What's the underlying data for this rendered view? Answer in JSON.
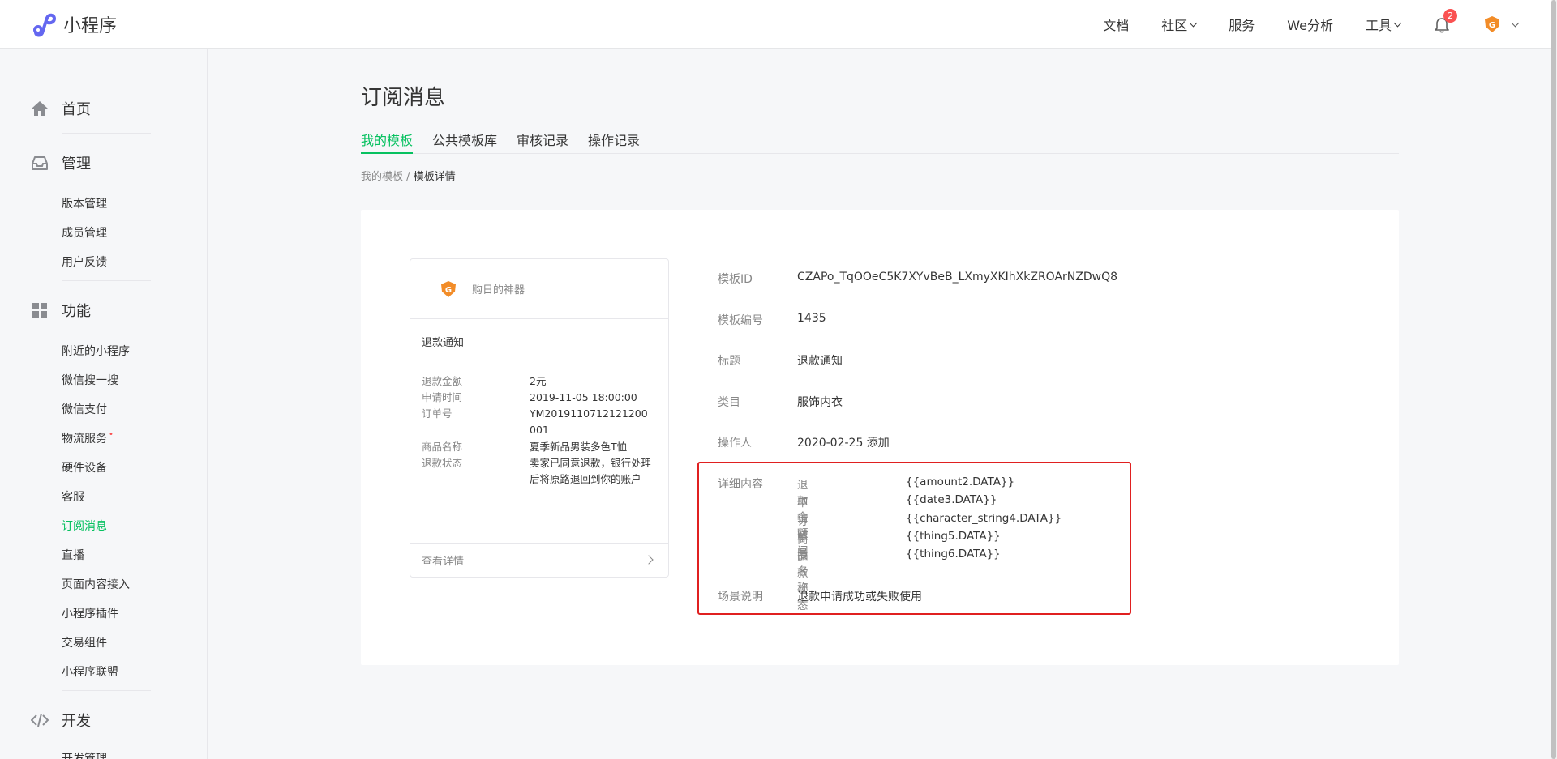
{
  "header": {
    "logo_text": "小程序",
    "nav": [
      {
        "label": "文档",
        "dropdown": false
      },
      {
        "label": "社区",
        "dropdown": true
      },
      {
        "label": "服务",
        "dropdown": false
      },
      {
        "label": "We分析",
        "dropdown": false
      },
      {
        "label": "工具",
        "dropdown": true
      }
    ],
    "notification_count": "2"
  },
  "sidebar": {
    "groups": [
      {
        "label": "首页",
        "icon": "home-icon"
      },
      {
        "label": "管理",
        "icon": "inbox-icon",
        "items": [
          "版本管理",
          "成员管理",
          "用户反馈"
        ]
      },
      {
        "label": "功能",
        "icon": "grid-icon",
        "items": [
          "附近的小程序",
          "微信搜一搜",
          "微信支付",
          "物流服务",
          "硬件设备",
          "客服",
          "订阅消息",
          "直播",
          "页面内容接入",
          "小程序插件",
          "交易组件",
          "小程序联盟"
        ]
      },
      {
        "label": "开发",
        "icon": "code-icon",
        "items": [
          "开发管理"
        ]
      }
    ],
    "active_item": "订阅消息",
    "new_dot": "•"
  },
  "page": {
    "title": "订阅消息",
    "tabs": [
      "我的模板",
      "公共模板库",
      "审核记录",
      "操作记录"
    ],
    "active_tab": "我的模板",
    "breadcrumb": {
      "parent": "我的模板",
      "separator": "/",
      "current": "模板详情"
    }
  },
  "preview": {
    "app_name": "购日的神器",
    "title": "退款通知",
    "fields": [
      {
        "key": "退款金额",
        "value": "2元"
      },
      {
        "key": "申请时间",
        "value": "2019-11-05 18:00:00"
      },
      {
        "key": "订单号",
        "value": "YM2019110712121200001"
      },
      {
        "key": "商品名称",
        "value": "夏季新品男装多色T恤"
      },
      {
        "key": "退款状态",
        "value": "卖家已同意退款，银行处理后将原路退回到你的账户"
      }
    ],
    "footer_link": "查看详情"
  },
  "template": {
    "rows": [
      {
        "label": "模板ID",
        "value": "CZAPo_TqOOeC5K7XYvBeB_LXmyXKIhXkZROArNZDwQ8"
      },
      {
        "label": "模板编号",
        "value": "1435"
      },
      {
        "label": "标题",
        "value": "退款通知"
      },
      {
        "label": "类目",
        "value": "服饰内衣"
      },
      {
        "label": "操作人",
        "value": "2020-02-25 添加"
      }
    ],
    "detail_label": "详细内容",
    "detail": [
      {
        "key": "退款金额",
        "value": "{{amount2.DATA}}"
      },
      {
        "key": "申请时间",
        "value": "{{date3.DATA}}"
      },
      {
        "key": "订单号",
        "value": "{{character_string4.DATA}}"
      },
      {
        "key": "商品名称",
        "value": "{{thing5.DATA}}"
      },
      {
        "key": "退款状态",
        "value": "{{thing6.DATA}}"
      }
    ],
    "scene_label": "场景说明",
    "scene_value": "退款申请成功或失败使用"
  },
  "colors": {
    "accent": "#07c160",
    "highlight": "#e02020",
    "badge": "#fa5151"
  }
}
